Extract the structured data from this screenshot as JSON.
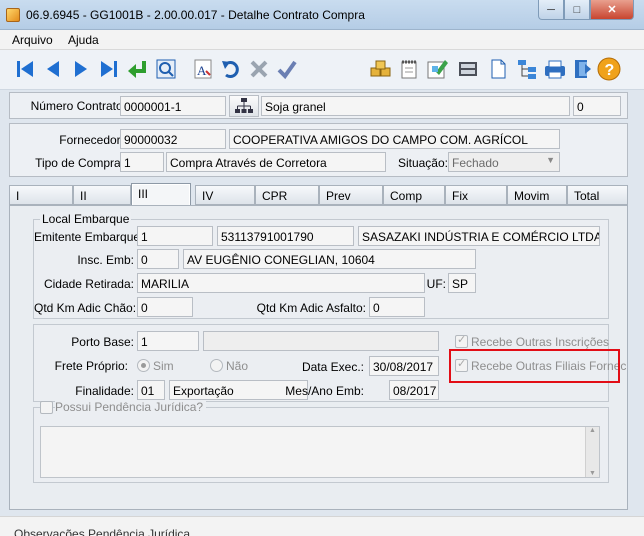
{
  "window": {
    "title": "06.9.6945 - GG1001B - 2.00.00.017 - Detalhe Contrato Compra",
    "minimize": "─",
    "maximize": "□",
    "close": "✕"
  },
  "menu": {
    "items": [
      "Arquivo",
      "Ajuda"
    ]
  },
  "toolbar": {
    "icons": [
      "first-icon",
      "prev-icon",
      "next-icon",
      "last-icon",
      "goto-icon",
      "search-icon",
      "font-icon",
      "undo-icon",
      "cancel-icon",
      "confirm-icon",
      "stack-icon",
      "notepad-icon",
      "edit-icon",
      "device-icon",
      "document-icon",
      "tree-icon",
      "print-icon",
      "help-icon"
    ]
  },
  "header": {
    "contract_label": "Número Contrato:",
    "contract_value": "0000001-1",
    "product": "Soja granel",
    "version": "0"
  },
  "supplier": {
    "fornecedor_label": "Fornecedor:",
    "fornecedor_code": "90000032",
    "fornecedor_name": "COOPERATIVA AMIGOS DO CAMPO COM. AGRÍCOL",
    "tipo_label": "Tipo de Compra:",
    "tipo_code": "1",
    "tipo_desc": "Compra Através de Corretora",
    "situacao_label": "Situação:",
    "situacao_value": "Fechado"
  },
  "tabs": [
    "I",
    "II",
    "III",
    "IV",
    "CPR",
    "Prev",
    "Comp",
    "Fix",
    "Movim",
    "Total"
  ],
  "active_tab": "III",
  "local_embarque": {
    "legend": "Local Embarque",
    "emitente_label": "Emitente Embarque:",
    "emitente_code": "1",
    "emitente_cnpj": "53113791001790",
    "emitente_name": "SASAZAKI INDÚSTRIA E COMÉRCIO LTDA AÇÃO",
    "insc_label": "Insc. Emb:",
    "insc_value": "0",
    "endereco": "AV EUGÊNIO CONEGLIAN, 10604",
    "cidade_label": "Cidade Retirada:",
    "cidade_value": "MARILIA",
    "uf_label": "UF:",
    "uf_value": "SP",
    "km_chao_label": "Qtd Km Adic Chão:",
    "km_chao_value": "0",
    "km_asfalto_label": "Qtd Km Adic Asfalto:",
    "km_asfalto_value": "0"
  },
  "porto": {
    "porto_label": "Porto Base:",
    "porto_code": "1",
    "porto_desc": "",
    "frete_label": "Frete Próprio:",
    "frete_sim": "Sim",
    "frete_nao": "Não",
    "data_exec_label": "Data Exec.:",
    "data_exec_value": "30/08/2017",
    "finalidade_label": "Finalidade:",
    "finalidade_code": "01",
    "finalidade_desc": "Exportação",
    "mes_ano_label": "Mes/Ano Emb:",
    "mes_ano_value": "08/2017",
    "recebe_inscricoes": "Recebe Outras Inscrições",
    "recebe_filiais": "Recebe Outras Filiais Fornec"
  },
  "pendencia": {
    "label": "Possui Pendência Jurídica?"
  },
  "status": {
    "text": "Observações Pendência Jurídica"
  }
}
